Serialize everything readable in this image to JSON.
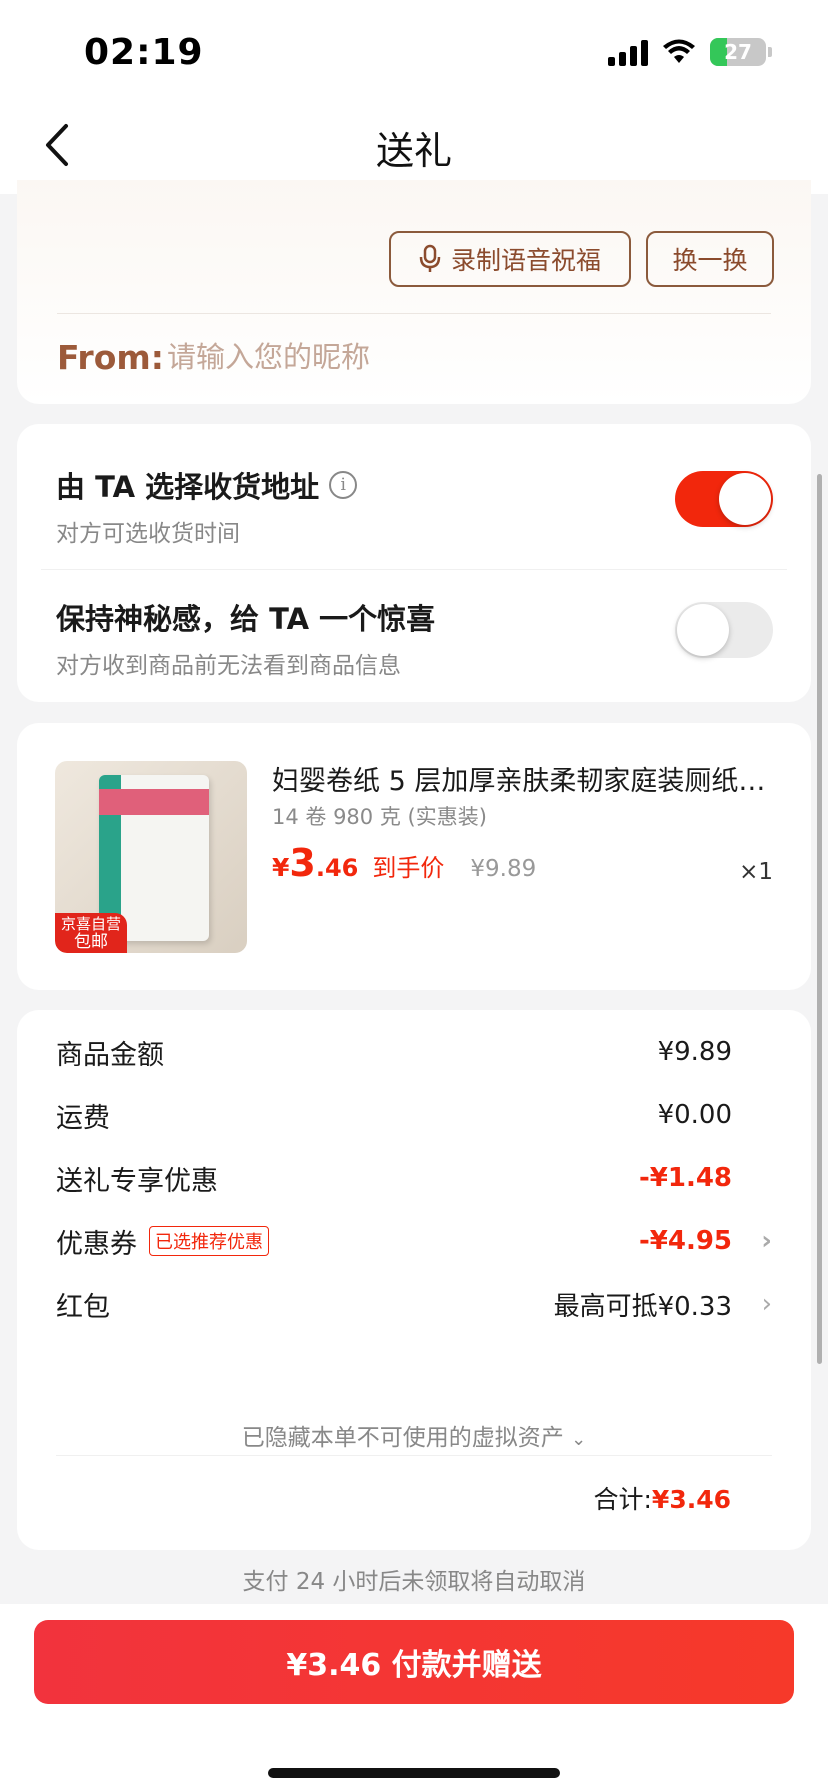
{
  "status_bar": {
    "time": "02:19",
    "battery": "27"
  },
  "nav": {
    "title": "送礼"
  },
  "message": {
    "record_button": "录制语音祝福",
    "swap_button": "换一换",
    "from_label": "From:",
    "from_placeholder": "请输入您的昵称"
  },
  "options": {
    "address": {
      "title": "由 TA 选择收货地址",
      "subtitle": "对方可选收货时间",
      "enabled": true
    },
    "mystery": {
      "title": "保持神秘感，给 TA 一个惊喜",
      "subtitle": "对方收到商品前无法看到商品信息",
      "enabled": false
    }
  },
  "product": {
    "name": "妇婴卷纸 5 层加厚亲肤柔韧家庭装厕纸…",
    "spec": "14 卷 980 克 (实惠装)",
    "price_symbol": "¥",
    "price_int": "3",
    "price_dec": ".46",
    "price_tag": "到手价",
    "original_price": "¥9.89",
    "quantity": "×1",
    "badge_line1": "京喜自营",
    "badge_line2": "包邮"
  },
  "summary": {
    "rows": [
      {
        "label": "商品金额",
        "value": "¥9.89"
      },
      {
        "label": "运费",
        "value": "¥0.00"
      },
      {
        "label": "送礼专享优惠",
        "value": "-¥1.48"
      },
      {
        "label": "优惠券",
        "tag": "已选推荐优惠",
        "value": "-¥4.95"
      },
      {
        "label": "红包",
        "value": "最高可抵¥0.33"
      }
    ],
    "hidden_assets": "已隐藏本单不可使用的虚拟资产",
    "total_label": "合计:",
    "total_value": "¥3.46"
  },
  "notice": "支付 24 小时后未领取将自动取消",
  "pay_button": "¥3.46 付款并赠送",
  "colors": {
    "accent": "#f2270c",
    "brown": "#8b4b2d"
  }
}
